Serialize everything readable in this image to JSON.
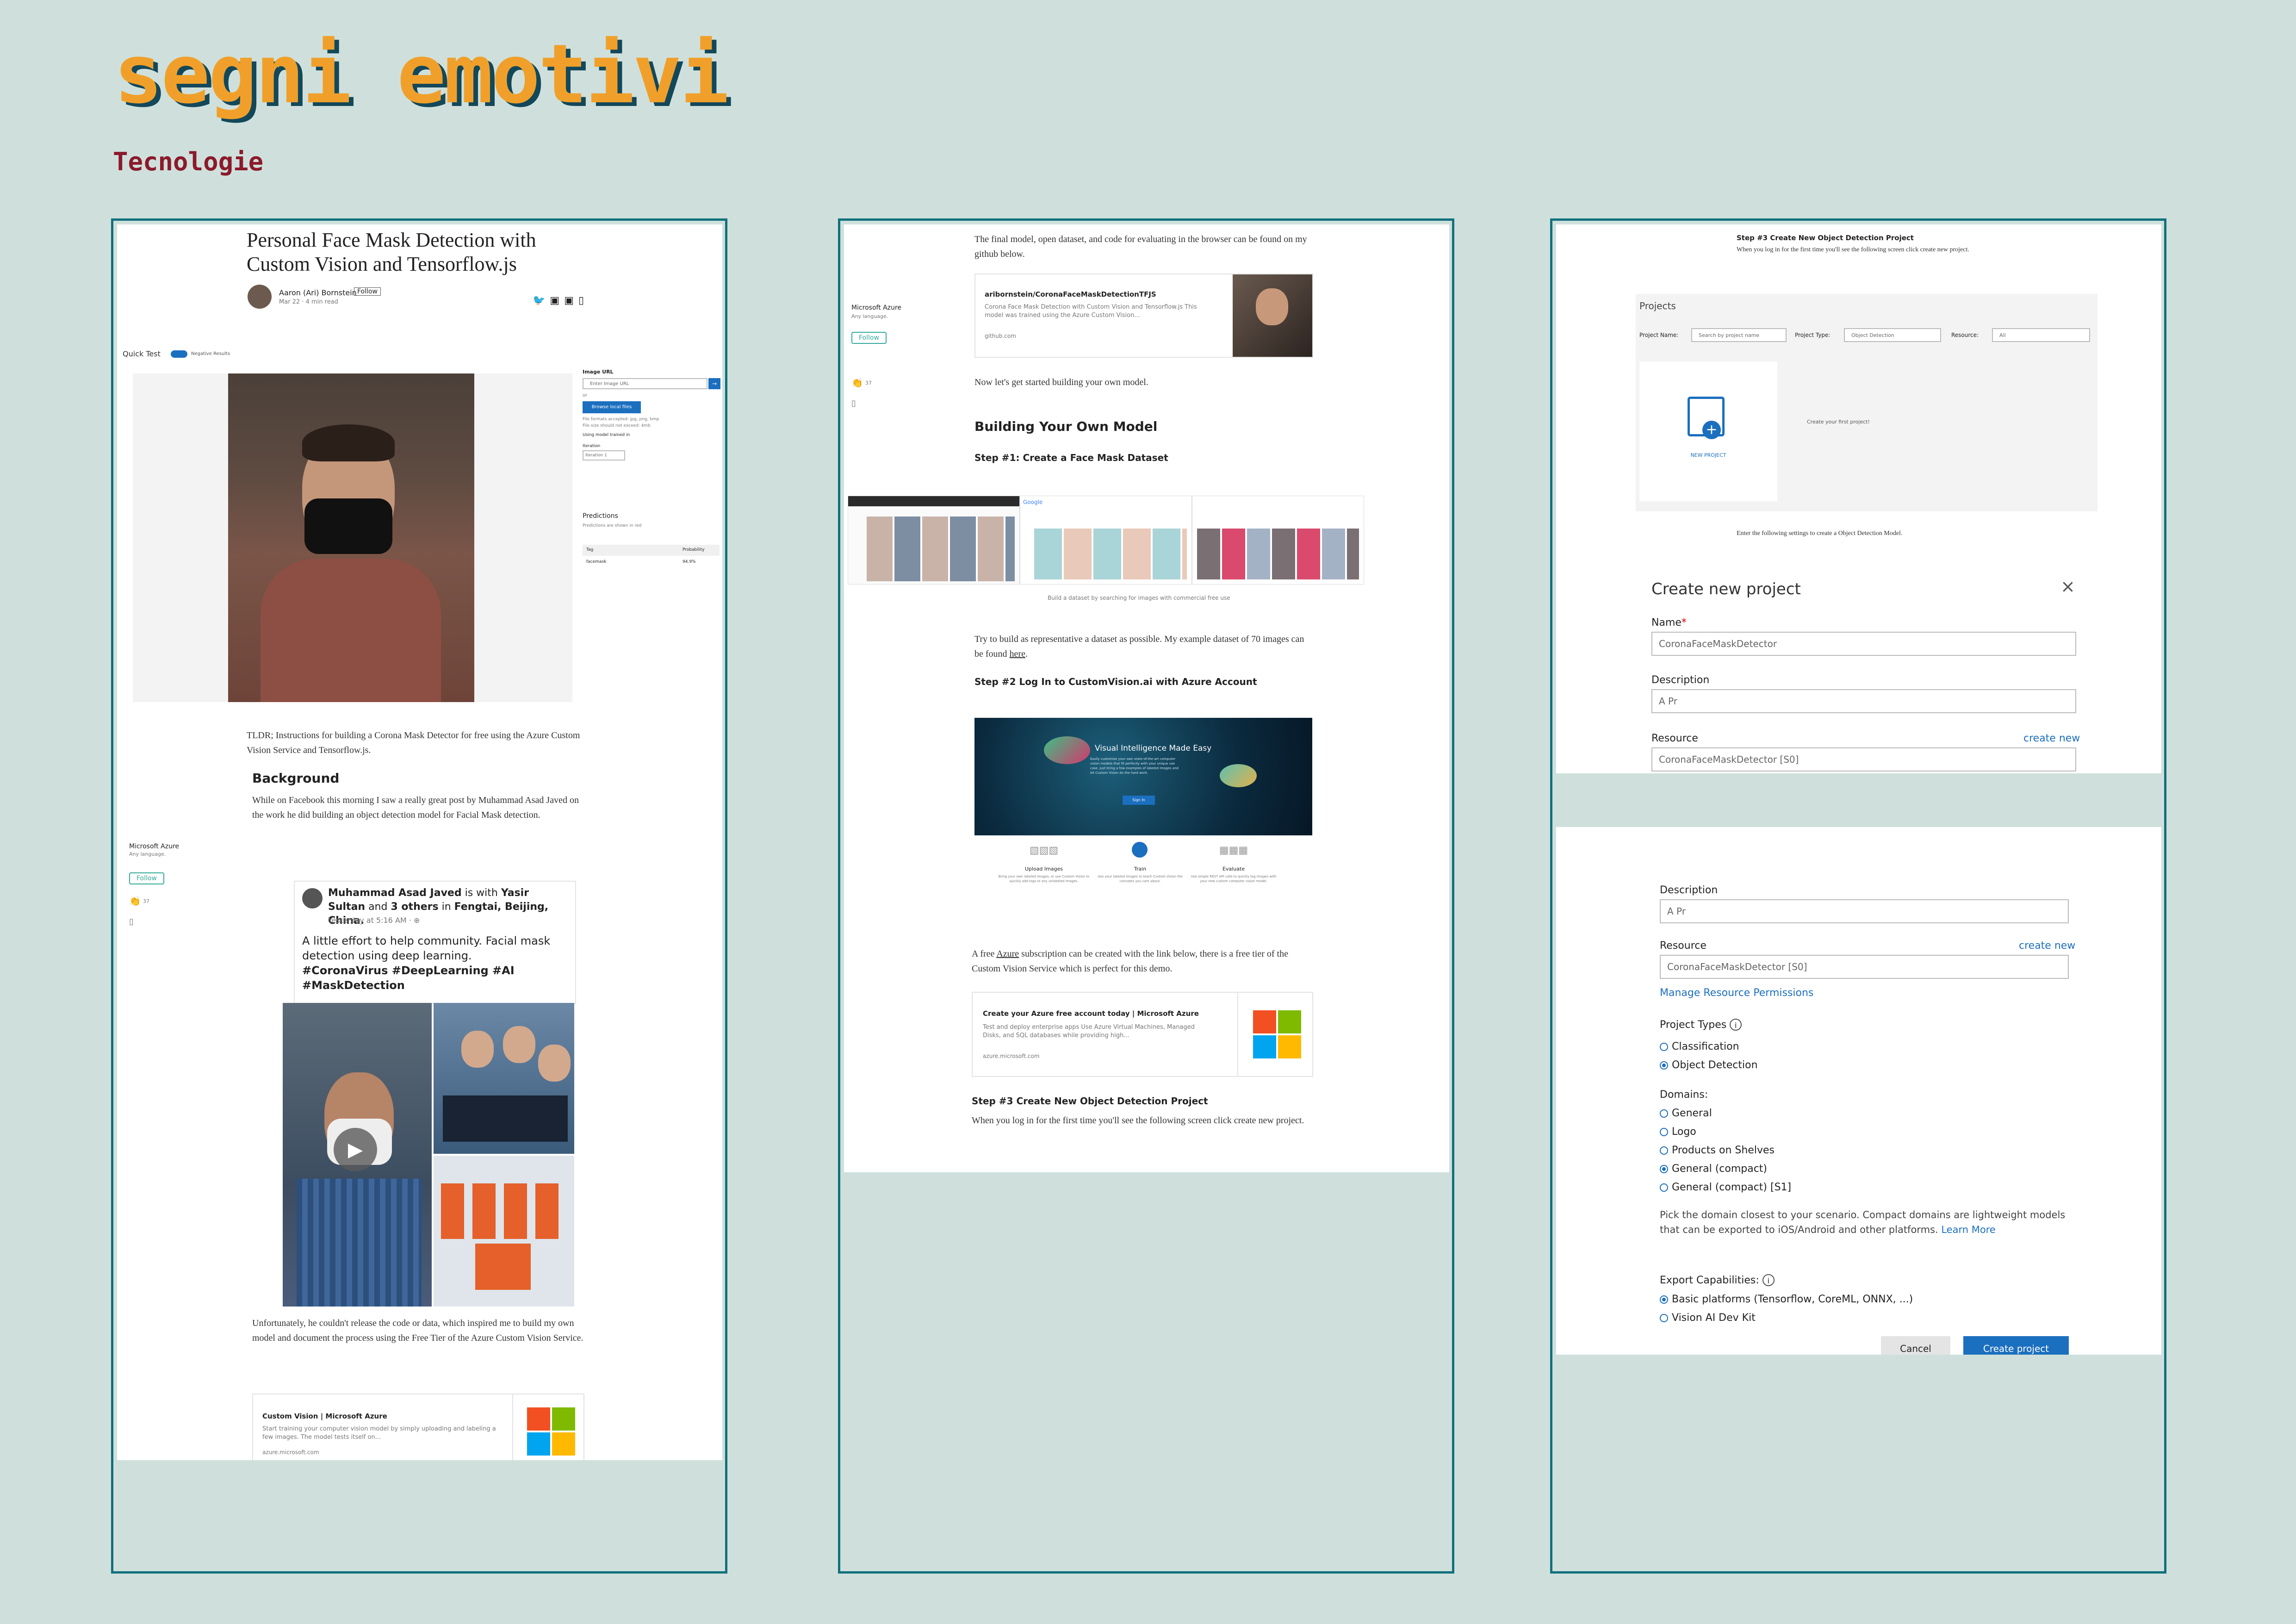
{
  "header": {
    "title": "segni emotivi",
    "subtitle": "Tecnologie"
  },
  "colors": {
    "background": "#cfe0dc",
    "title_fill": "#f0a02a",
    "title_shadow": "#13485a",
    "subtitle": "#8b1a2b",
    "panel_border": "#11707c",
    "azure_blue": "#1b6fbf"
  },
  "panel1": {
    "article_title_1": "Personal Face Mask Detection with",
    "article_title_2": "Custom Vision and Tensorflow.js",
    "author": "Aaron (Ari) Bornstein",
    "follow": "Follow",
    "date": "Mar 22 · 4 min read",
    "quick_test": "Quick Test",
    "negative_results": "Negative Results",
    "image_url_label": "Image URL",
    "image_url_placeholder": "Enter Image URL",
    "or": "or",
    "browse": "Browse local files",
    "file_formats": "File formats accepted: jpg, png, bmp",
    "file_size": "File size should not exceed: 4mb",
    "using_model": "Using model trained in",
    "iteration_label": "Iteration",
    "iteration_value": "Iteration 1",
    "predictions_title": "Predictions",
    "predictions_note": "Predictions are shown in red",
    "tag_header": "Tag",
    "prob_header": "Probability",
    "tag_value": "facemask",
    "prob_value": "94.9%",
    "tldr": "TLDR; Instructions for building a Corona Mask Detector for free using the Azure Custom Vision Service and Tensorflow.js.",
    "background_heading": "Background",
    "background_text": "While on Facebook this morning I saw a really great post by Muhammad Asad Javed on the work he did building an object detection model for Facial Mask detection.",
    "side_pub": "Microsoft Azure",
    "side_pub_sub": "Any language.",
    "side_follow": "Follow",
    "claps": "37",
    "fb_name": "Muhammad Asad Javed",
    "fb_with": "is with",
    "fb_with_name": "Yasir Sultan",
    "fb_and": "and",
    "fb_others": "3 others",
    "fb_in": "in",
    "fb_place": "Fengtai, Beijing, China.",
    "fb_time": "Yesterday at 5:16 AM · ",
    "fb_post": "A little effort to help community. Facial mask detection using deep learning.",
    "fb_tags": "#CoronaVirus #DeepLearning #AI #MaskDetection",
    "unfortunately": "Unfortunately, he couldn't release the code or data, which inspired me to build my own model and document the process using the Free Tier of the Azure Custom Vision Service.",
    "cv_card_title": "Custom Vision | Microsoft Azure",
    "cv_card_desc": "Start training your computer vision model by simply uploading and labeling a few images. The model tests itself on...",
    "cv_card_url": "azure.microsoft.com"
  },
  "panel2": {
    "intro": "The final model, open dataset, and code for evaluating in the browser can be found on my github below.",
    "side_pub": "Microsoft Azure",
    "side_pub_sub": "Any language.",
    "side_follow": "Follow",
    "claps": "37",
    "gh_card_title": "aribornstein/CoronaFaceMaskDetectionTFJS",
    "gh_card_desc": "Corona Face Mask Detection with Custom Vision and Tensorflow.js This model was trained using the Azure Custom Vision...",
    "gh_card_url": "github.com",
    "now_lets": "Now let's get started building your own model.",
    "building_heading": "Building Your Own Model",
    "step1": "Step #1: Create a Face Mask Dataset",
    "dataset_caption": "Build a dataset by searching for images with commercial free use",
    "try_build": "Try to build as representative a dataset as possible. My example dataset of 70 images can be found ",
    "here": "here",
    "step2": "Step #2 Log In to CustomVision.ai with Azure Account",
    "vis_title": "Visual Intelligence Made Easy",
    "vis_sub": "Easily customize your own state-of-the-art computer vision models that fit perfectly with your unique use case. Just bring a few examples of labeled images and let Custom Vision do the hard work.",
    "sign_in": "Sign In",
    "upload_label": "Upload Images",
    "upload_desc": "Bring your own labeled images, or use Custom Vision to quickly add tags to any unlabeled images.",
    "train_label": "Train",
    "train_desc": "Use your labeled images to teach Custom Vision the concepts you care about.",
    "evaluate_label": "Evaluate",
    "evaluate_desc": "Use simple REST API calls to quickly tag images with your new custom computer vision model.",
    "free_azure": "A free ",
    "azure_link": "Azure",
    "free_azure_rest": " subscription can be created with the link below, there is a free tier of the Custom Vision Service which is perfect for this demo.",
    "az_card_title": "Create your Azure free account today | Microsoft Azure",
    "az_card_desc": "Test and deploy enterprise apps Use Azure Virtual Machines, Managed Disks, and SQL databases while providing high...",
    "az_card_url": "azure.microsoft.com",
    "step3": "Step #3 Create New Object Detection Project",
    "step3_text": "When you log in for the first time you'll see the following screen click create new project."
  },
  "panel3": {
    "step3": "Step #3 Create New Object Detection Project",
    "step3_text": "When you log in for the first time you'll see the following screen click create new project.",
    "projects_title": "Projects",
    "project_name_label": "Project Name:",
    "project_name_placeholder": "Search by project name",
    "project_type_label": "Project Type:",
    "project_type_value": "Object Detection",
    "resource_label": "Resource:",
    "resource_value": "All",
    "new_project": "NEW PROJECT",
    "create_first": "Create your first project!",
    "enter_settings": "Enter the following settings to create a Object Detection Model.",
    "dialog_title": "Create new project",
    "name_label": "Name",
    "name_value": "CoronaFaceMaskDetector",
    "description_label": "Description",
    "description_value": "A Pr",
    "resource_field_label": "Resource",
    "create_new": "create new",
    "resource_field_value": "CoronaFaceMaskDetector [S0]",
    "manage_permissions": "Manage Resource Permissions",
    "project_types_label": "Project Types",
    "classification": "Classification",
    "object_detection": "Object Detection",
    "domains_label": "Domains:",
    "domains": [
      "General",
      "Logo",
      "Products on Shelves",
      "General (compact)",
      "General (compact) [S1]"
    ],
    "domain_note": "Pick the domain closest to your scenario. Compact domains are lightweight models that can be exported to iOS/Android and other platforms.",
    "learn_more": "Learn More",
    "export_label": "Export Capabilities:",
    "export_basic": "Basic platforms (Tensorflow, CoreML, ONNX, ...)",
    "export_vision": "Vision AI Dev Kit",
    "cancel": "Cancel",
    "create_project": "Create project"
  }
}
